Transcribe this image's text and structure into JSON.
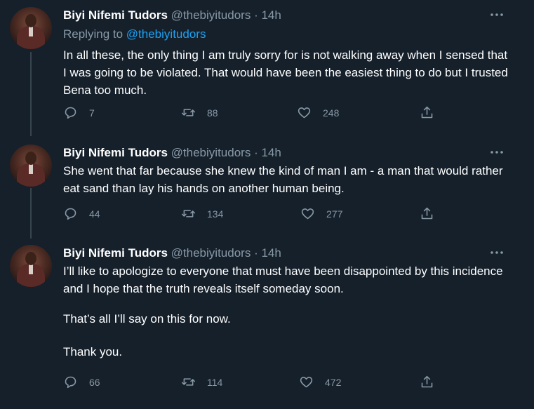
{
  "tweets": [
    {
      "name": "Biyi Nifemi Tudors",
      "handle": "@thebiyitudors",
      "dot": "·",
      "time": "14h",
      "replying_label": "Replying to",
      "replying_to": "@thebiyitudors",
      "text": [
        "In all these, the only thing I am truly sorry for is not walking away when I sensed that I was going to be violated. That would have been the easiest thing to do but I trusted Bena too much."
      ],
      "replies": "7",
      "retweets": "88",
      "likes": "248"
    },
    {
      "name": "Biyi Nifemi Tudors",
      "handle": "@thebiyitudors",
      "dot": "·",
      "time": "14h",
      "text": [
        "She went that far because she knew the kind of man I am - a man that would rather eat sand than lay his hands on another human being."
      ],
      "replies": "44",
      "retweets": "134",
      "likes": "277"
    },
    {
      "name": "Biyi Nifemi Tudors",
      "handle": "@thebiyitudors",
      "dot": "·",
      "time": "14h",
      "text": [
        "I’ll like to apologize to everyone that must have been disappointed by this incidence and I hope that the truth reveals itself someday soon.",
        "That’s all I’ll say on this for now.",
        "Thank you."
      ],
      "replies": "66",
      "retweets": "114",
      "likes": "472"
    }
  ],
  "icons": {
    "more": "more-horizontal-icon",
    "reply": "reply-bubble-icon",
    "retweet": "retweet-icon",
    "like": "heart-icon",
    "share": "share-icon"
  },
  "colors": {
    "background": "#15202b",
    "text": "#ffffff",
    "secondary": "#8899a6",
    "link": "#1da1f2",
    "thread_line": "#38444d"
  }
}
